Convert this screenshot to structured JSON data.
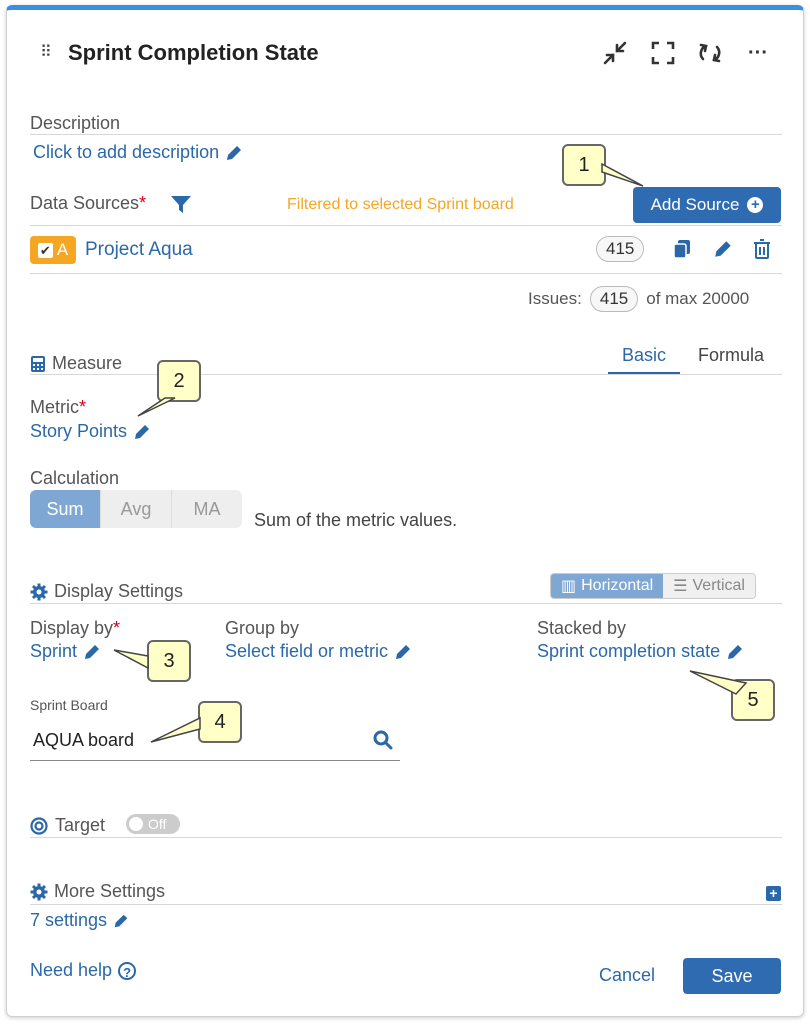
{
  "header": {
    "title": "Sprint Completion State"
  },
  "description": {
    "label": "Description",
    "placeholder": "Click to add description"
  },
  "data_sources": {
    "label": "Data Sources",
    "required_mark": "*",
    "filter_note": "Filtered to selected Sprint board",
    "add_button": "Add Source",
    "items": [
      {
        "badge": "A",
        "name": "Project Aqua",
        "count": "415"
      }
    ],
    "issues_label": "Issues:",
    "issues_count": "415",
    "issues_suffix": "of max 20000"
  },
  "measure": {
    "label": "Measure",
    "tabs": [
      "Basic",
      "Formula"
    ],
    "metric_label": "Metric",
    "metric_value": "Story Points",
    "calculation_label": "Calculation",
    "calculation_options": [
      "Sum",
      "Avg",
      "MA"
    ],
    "calculation_description": "Sum of the metric values."
  },
  "display_settings": {
    "label": "Display Settings",
    "orientation": [
      "Horizontal",
      "Vertical"
    ],
    "display_by_label": "Display by",
    "display_by_value": "Sprint",
    "group_by_label": "Group by",
    "group_by_value": "Select field or metric",
    "stacked_by_label": "Stacked by",
    "stacked_by_value": "Sprint completion state",
    "sprint_board_label": "Sprint Board",
    "sprint_board_value": "AQUA board"
  },
  "target": {
    "label": "Target",
    "toggle": "Off"
  },
  "more_settings": {
    "label": "More Settings",
    "link": "7 settings"
  },
  "footer": {
    "help": "Need help",
    "cancel": "Cancel",
    "save": "Save"
  },
  "callouts": [
    "1",
    "2",
    "3",
    "4",
    "5"
  ],
  "colors": {
    "accent": "#2e6bb0",
    "link": "#2b68a8",
    "warning": "#f5a623",
    "callout_bg": "#ffffc8"
  }
}
